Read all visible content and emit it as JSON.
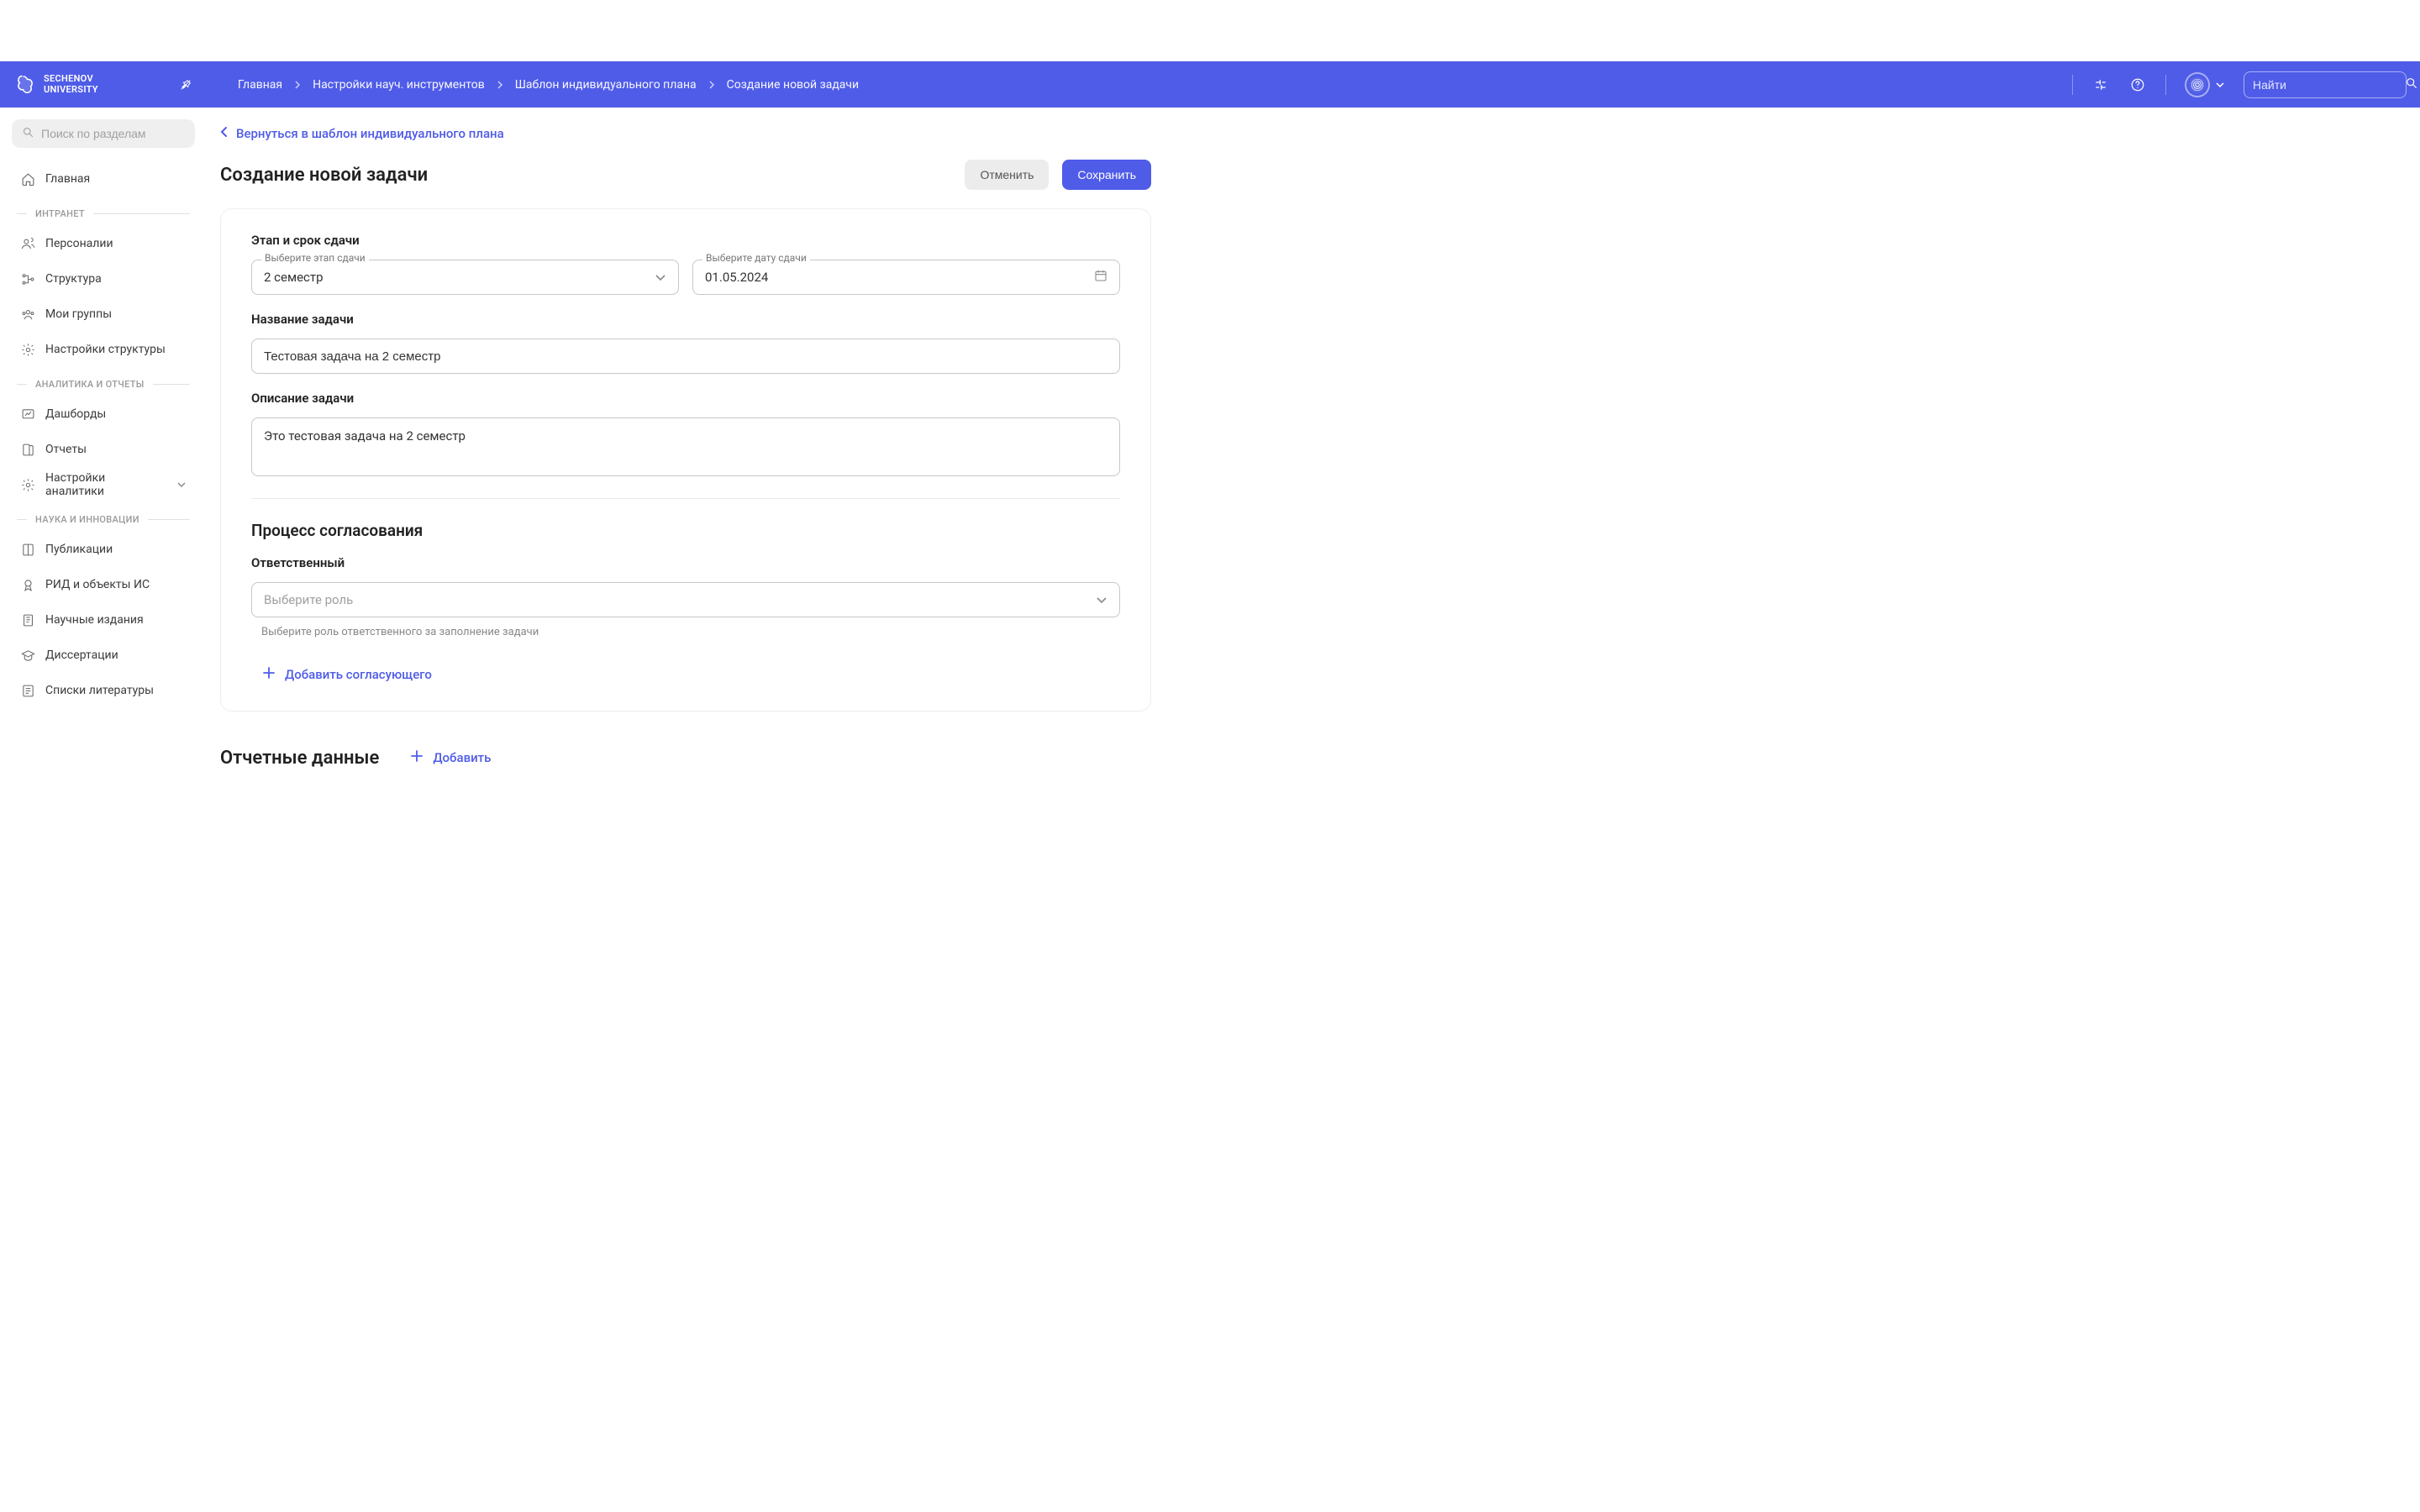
{
  "brand": {
    "line1": "SECHENOV",
    "line2": "UNIVERSITY"
  },
  "breadcrumbs": {
    "items": [
      "Главная",
      "Настройки науч. инструментов",
      "Шаблон индивидуального плана",
      "Создание новой задачи"
    ]
  },
  "header": {
    "search_placeholder": "Найти"
  },
  "sidebar": {
    "search_placeholder": "Поиск по разделам",
    "home": "Главная",
    "sections": {
      "intranet": "ИНТРАНЕТ",
      "analytics": "АНАЛИТИКА И ОТЧЕТЫ",
      "science": "НАУКА И ИННОВАЦИИ"
    },
    "items": {
      "personalii": "Персоналии",
      "struktura": "Структура",
      "moi_gruppy": "Мои группы",
      "nastroiki_struktury": "Настройки структуры",
      "dashbordy": "Дашборды",
      "otchety": "Отчеты",
      "nastroiki_analitiki": "Настройки аналитики",
      "publikacii": "Публикации",
      "rid": "РИД и объекты ИС",
      "nauch_izdaniya": "Научные издания",
      "dissertacii": "Диссертации",
      "spiski_lit": "Списки литературы"
    }
  },
  "page": {
    "back_link": "Вернуться в шаблон индивидуального плана",
    "title": "Создание новой задачи",
    "cancel": "Отменить",
    "save": "Сохранить"
  },
  "form": {
    "stage_heading": "Этап и срок сдачи",
    "stage_label": "Выберите этап сдачи",
    "stage_value": "2 семестр",
    "date_label": "Выберите дату сдачи",
    "date_value": "01.05.2024",
    "task_name_label": "Название задачи",
    "task_name_value": "Тестовая задача на 2 семестр",
    "task_desc_label": "Описание задачи",
    "task_desc_value": "Это тестовая задача на 2 семестр",
    "approval_heading": "Процесс согласования",
    "responsible_label": "Ответственный",
    "responsible_placeholder": "Выберите роль",
    "responsible_helper": "Выберите роль ответственного за заполнение задачи",
    "add_approver": "Добавить согласующего",
    "report_heading": "Отчетные данные",
    "add_report": "Добавить"
  }
}
